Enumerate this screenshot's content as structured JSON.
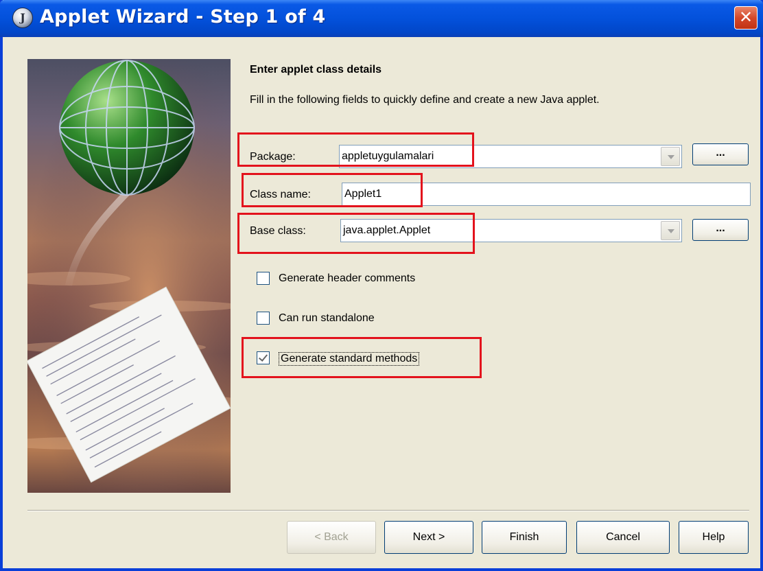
{
  "window": {
    "title": "Applet Wizard - Step 1 of 4"
  },
  "content": {
    "heading": "Enter applet class details",
    "description": "Fill in the following fields to quickly define and create a new Java applet."
  },
  "form": {
    "package": {
      "label": "Package:",
      "value": "appletuygulamalari",
      "browse_label": "..."
    },
    "class_name": {
      "label": "Class name:",
      "value": "Applet1"
    },
    "base_class": {
      "label": "Base class:",
      "value": "java.applet.Applet",
      "browse_label": "..."
    },
    "options": [
      {
        "label": "Generate header comments",
        "checked": false
      },
      {
        "label": "Can run standalone",
        "checked": false
      },
      {
        "label": "Generate standard methods",
        "checked": true
      }
    ]
  },
  "buttons": {
    "back": "< Back",
    "next": "Next >",
    "finish": "Finish",
    "cancel": "Cancel",
    "help": "Help"
  },
  "colors": {
    "titlebar": "#0351db",
    "dialog_bg": "#ece9d8",
    "annotation_red": "#e3121c"
  }
}
